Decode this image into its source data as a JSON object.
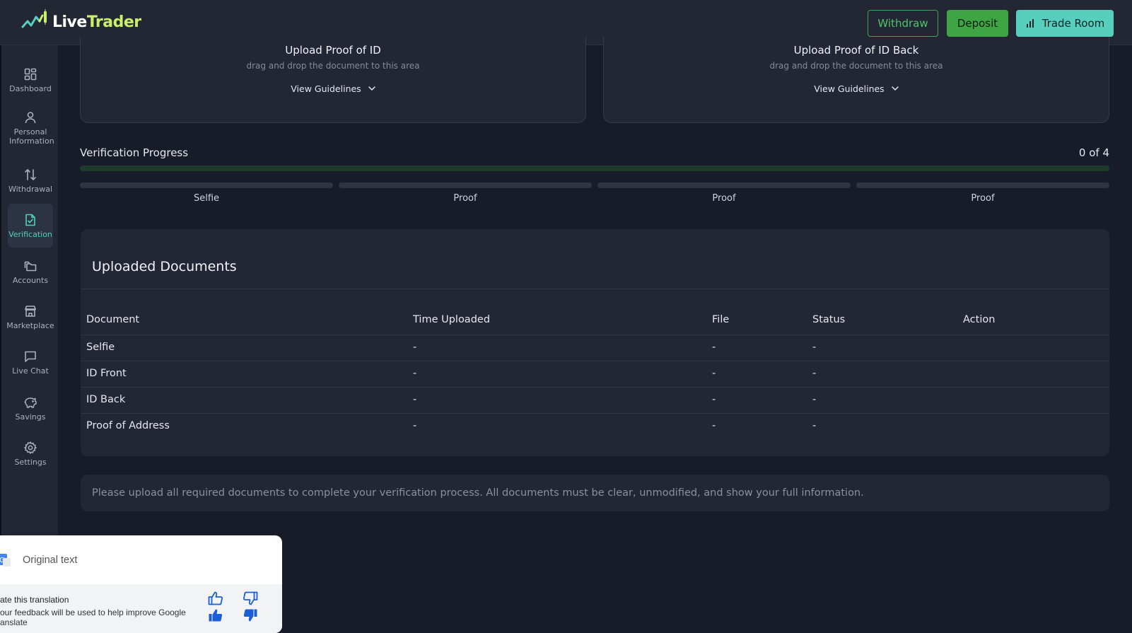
{
  "brand": {
    "name_part1": "Live",
    "name_part2": "Trader"
  },
  "header": {
    "withdraw_label": "Withdraw",
    "deposit_label": "Deposit",
    "trade_room_label": "Trade Room"
  },
  "sidebar": {
    "items": [
      {
        "label": "Dashboard",
        "icon": "dashboard-icon"
      },
      {
        "label": "Personal Information",
        "icon": "user-icon"
      },
      {
        "label": "Withdrawal",
        "icon": "arrows-up-down-icon"
      },
      {
        "label": "Verification",
        "icon": "document-check-icon",
        "active": true
      },
      {
        "label": "Accounts",
        "icon": "folders-icon"
      },
      {
        "label": "Marketplace",
        "icon": "store-icon"
      },
      {
        "label": "Live Chat",
        "icon": "chat-icon"
      },
      {
        "label": "Savings",
        "icon": "piggy-bank-icon"
      },
      {
        "label": "Settings",
        "icon": "gear-icon"
      }
    ]
  },
  "uploads": [
    {
      "title": "Upload Proof of ID",
      "subtitle": "drag and drop the document to this area",
      "guidelines_label": "View Guidelines"
    },
    {
      "title": "Upload Proof of ID Back",
      "subtitle": "drag and drop the document to this area",
      "guidelines_label": "View Guidelines"
    }
  ],
  "progress": {
    "title": "Verification Progress",
    "count_label": "0 of 4",
    "completed": 0,
    "total": 4,
    "steps": [
      "Selfie",
      "Proof",
      "Proof",
      "Proof"
    ]
  },
  "documents": {
    "title": "Uploaded Documents",
    "columns": [
      "Document",
      "Time Uploaded",
      "File",
      "Status",
      "Action"
    ],
    "rows": [
      {
        "document": "Selfie",
        "time": "-",
        "file": "-",
        "status": "-"
      },
      {
        "document": "ID Front",
        "time": "-",
        "file": "-",
        "status": "-"
      },
      {
        "document": "ID Back",
        "time": "-",
        "file": "-",
        "status": "-"
      },
      {
        "document": "Proof of Address",
        "time": "-",
        "file": "-",
        "status": "-"
      }
    ]
  },
  "notice": "Please upload all required documents to complete your verification process. All documents must be clear, unmodified, and show your full information.",
  "translate_popup": {
    "original_text_label": "Original text",
    "rate_label": "ate this translation",
    "feedback_line1": "our feedback will be used to help improve Google",
    "feedback_line2": "anslate"
  },
  "colors": {
    "accent_green": "#3fa443",
    "accent_teal": "#56cfbe",
    "active_nav": "#4fd1b5",
    "logo_lime": "#c9f06b"
  }
}
